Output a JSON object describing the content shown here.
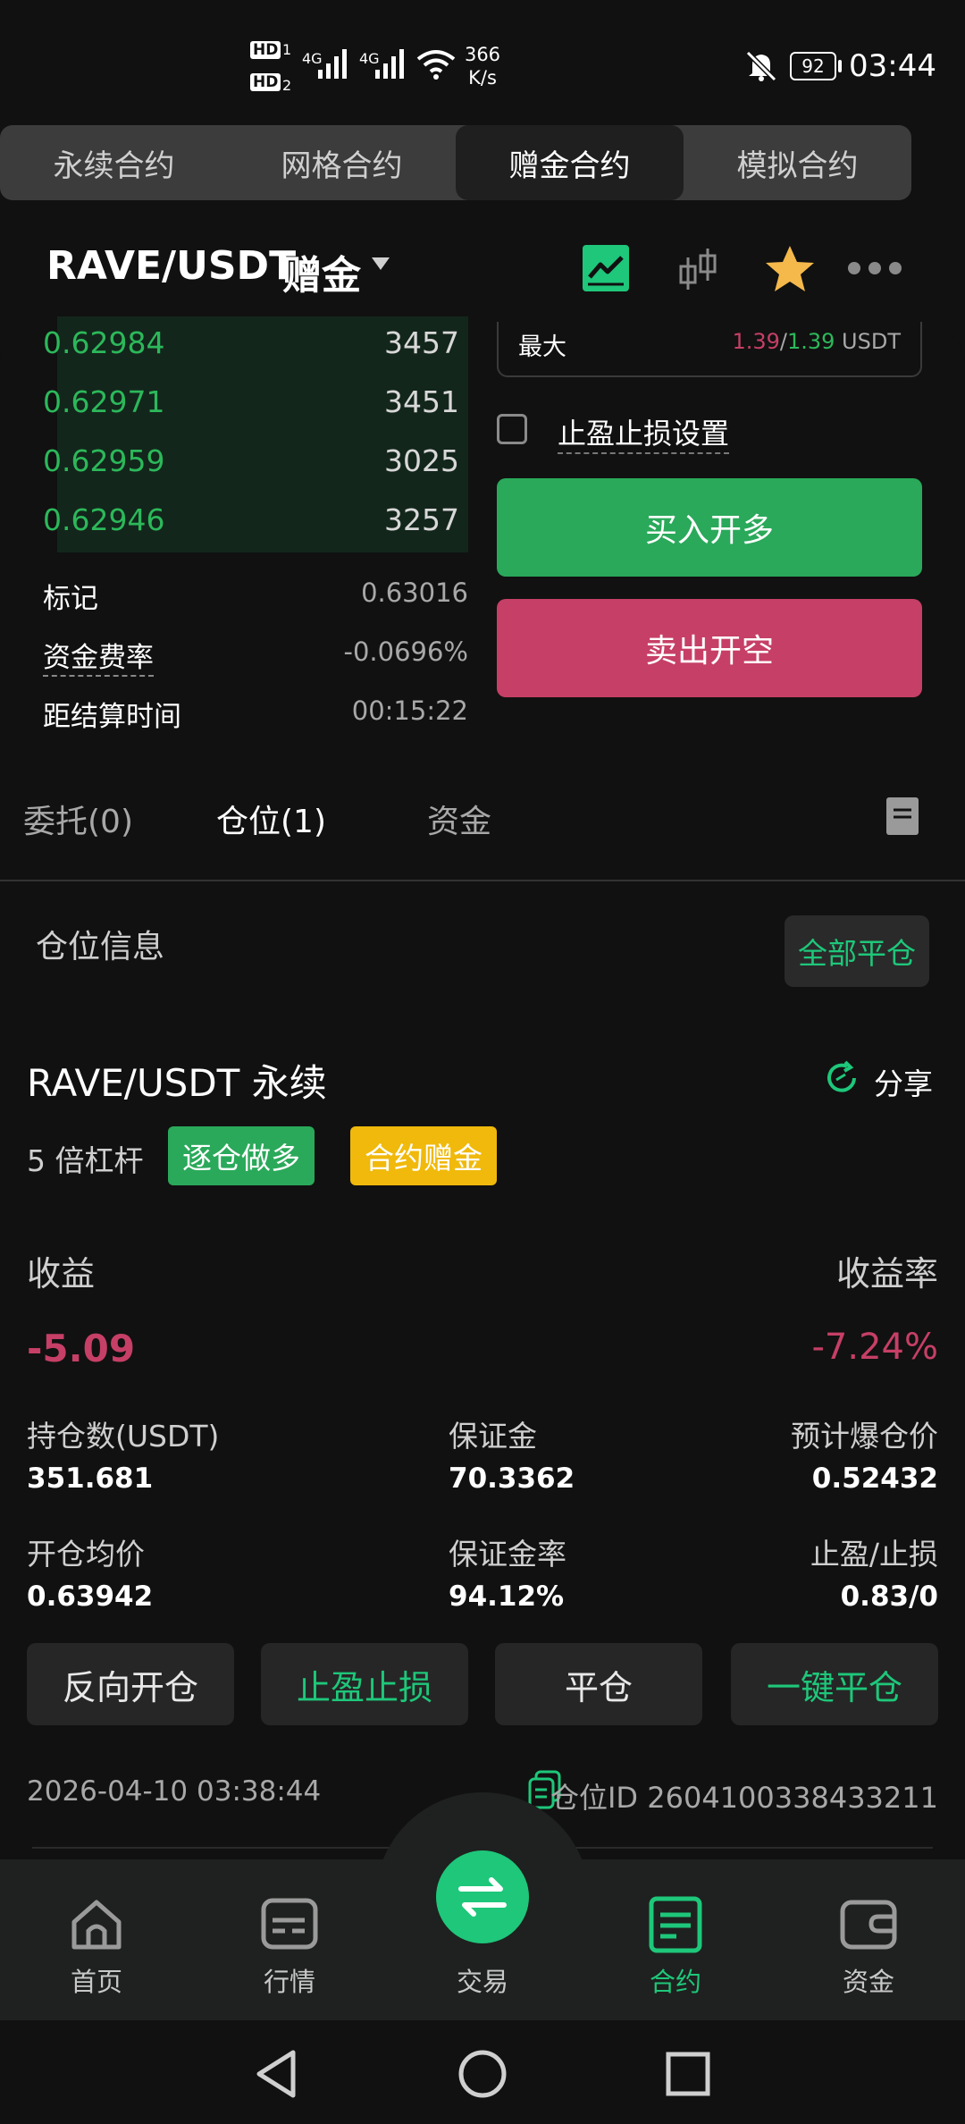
{
  "status_bar": {
    "hd1": "HD",
    "sim1": "1",
    "hd2": "HD",
    "sim2": "2",
    "net1": "4G",
    "net2": "4G",
    "speed_value": "366",
    "speed_unit": "K/s",
    "battery": "92",
    "time": "03:44"
  },
  "top_tabs": [
    {
      "label": "永续合约",
      "active": false
    },
    {
      "label": "网格合约",
      "active": false
    },
    {
      "label": "赠金合约",
      "active": true
    },
    {
      "label": "模拟合约",
      "active": false
    }
  ],
  "header": {
    "pair": "RAVE/USDT",
    "bonus_label": "赠金",
    "icons": [
      "chart-line-icon",
      "candlestick-icon",
      "star-icon",
      "more-icon"
    ]
  },
  "order_book": [
    {
      "price": "0.62984",
      "qty": "3457"
    },
    {
      "price": "0.62971",
      "qty": "3451"
    },
    {
      "price": "0.62959",
      "qty": "3025"
    },
    {
      "price": "0.62946",
      "qty": "3257"
    }
  ],
  "market_info": {
    "mark_label": "标记",
    "mark_value": "0.63016",
    "funding_label": "资金费率",
    "funding_value": "-0.0696%",
    "settle_label": "距结算时间",
    "settle_value": "00:15:22"
  },
  "order_panel": {
    "max_label": "最大",
    "max_buy": "1.39",
    "slash": "/",
    "max_sell": "1.39",
    "max_unit": "USDT",
    "tp_sl_label": "止盈止损设置",
    "buy_label": "买入开多",
    "sell_label": "卖出开空"
  },
  "position_tabs": [
    {
      "label": "委托(0)",
      "active": false
    },
    {
      "label": "仓位(1)",
      "active": true
    },
    {
      "label": "资金",
      "active": false
    }
  ],
  "position": {
    "section_title": "仓位信息",
    "close_all_label": "全部平仓",
    "symbol": "RAVE/USDT 永续",
    "share_label": "分享",
    "leverage": "5 倍杠杆",
    "tag_mode": "逐仓做多",
    "tag_bonus": "合约赠金",
    "pnl_label": "收益",
    "pnl_value": "-5.09",
    "roe_label": "收益率",
    "roe_value": "-7.24%",
    "size_label": "持仓数(USDT)",
    "size_value": "351.681",
    "margin_label": "保证金",
    "margin_value": "70.3362",
    "liq_label": "预计爆仓价",
    "liq_value": "0.52432",
    "entry_label": "开仓均价",
    "entry_value": "0.63942",
    "margin_rate_label": "保证金率",
    "margin_rate_value": "94.12%",
    "tpsl_label": "止盈/止损",
    "tpsl_value": "0.83/0",
    "actions": [
      "反向开仓",
      "止盈止损",
      "平仓",
      "一键平仓"
    ],
    "timestamp": "2026-04-10 03:38:44",
    "position_id": "仓位ID 2604100338433211"
  },
  "bottom_nav": [
    {
      "label": "首页",
      "icon": "home-icon",
      "active": false
    },
    {
      "label": "行情",
      "icon": "market-icon",
      "active": false
    },
    {
      "label": "交易",
      "icon": "swap-icon",
      "active": false
    },
    {
      "label": "合约",
      "icon": "contract-icon",
      "active": true
    },
    {
      "label": "资金",
      "icon": "wallet-icon",
      "active": false
    }
  ],
  "colors": {
    "green": "#2cb85a",
    "red": "#c63f66",
    "accent": "#1ec77a",
    "yellow": "#f0b90b"
  }
}
